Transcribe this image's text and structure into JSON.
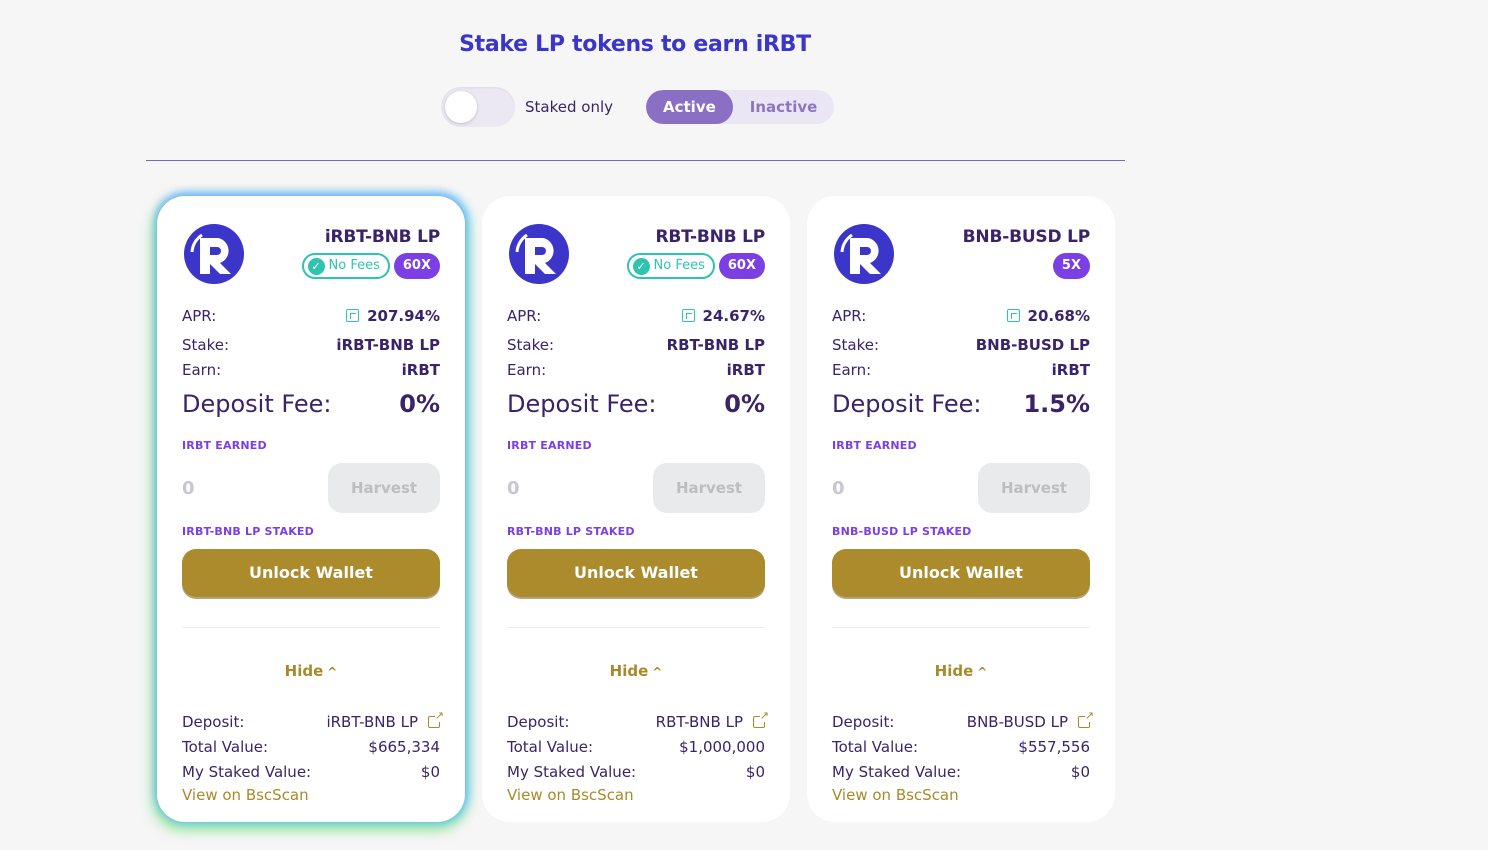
{
  "page": {
    "title": "Stake LP tokens to earn iRBT"
  },
  "controls": {
    "staked_only_label": "Staked only",
    "tabs": [
      {
        "label": "Active",
        "selected": true
      },
      {
        "label": "Inactive",
        "selected": false
      }
    ]
  },
  "colors": {
    "accent": "#3b35c9",
    "gold": "#ab8b2c",
    "teal": "#2fc4b0",
    "purple": "#7b3fe4"
  },
  "labels": {
    "apr": "APR:",
    "stake": "Stake:",
    "earn": "Earn:",
    "deposit_fee": "Deposit Fee:",
    "earned_token": "IRBT",
    "earned_suffix": "EARNED",
    "staked_suffix": "STAKED",
    "harvest": "Harvest",
    "unlock_wallet": "Unlock Wallet",
    "hide": "Hide",
    "deposit": "Deposit:",
    "total_value": "Total Value:",
    "my_staked_value": "My Staked Value:",
    "view_on_bscscan": "View on BscScan",
    "no_fees": "No Fees"
  },
  "cards": [
    {
      "title": "iRBT-BNB LP",
      "no_fees": true,
      "multiplier": "60X",
      "apr": "207.94%",
      "stake": "iRBT-BNB LP",
      "earn": "iRBT",
      "deposit_fee": "0%",
      "earned": "0",
      "staked_label_token": "IRBT-BNB LP",
      "deposit": "iRBT-BNB LP",
      "total_value": "$665,334",
      "my_staked_value": "$0",
      "highlighted": true
    },
    {
      "title": "RBT-BNB LP",
      "no_fees": true,
      "multiplier": "60X",
      "apr": "24.67%",
      "stake": "RBT-BNB LP",
      "earn": "iRBT",
      "deposit_fee": "0%",
      "earned": "0",
      "staked_label_token": "RBT-BNB LP",
      "deposit": "RBT-BNB LP",
      "total_value": "$1,000,000",
      "my_staked_value": "$0",
      "highlighted": false
    },
    {
      "title": "BNB-BUSD LP",
      "no_fees": false,
      "multiplier": "5X",
      "apr": "20.68%",
      "stake": "BNB-BUSD LP",
      "earn": "iRBT",
      "deposit_fee": "1.5%",
      "earned": "0",
      "staked_label_token": "BNB-BUSD LP",
      "deposit": "BNB-BUSD LP",
      "total_value": "$557,556",
      "my_staked_value": "$0",
      "highlighted": false
    }
  ]
}
